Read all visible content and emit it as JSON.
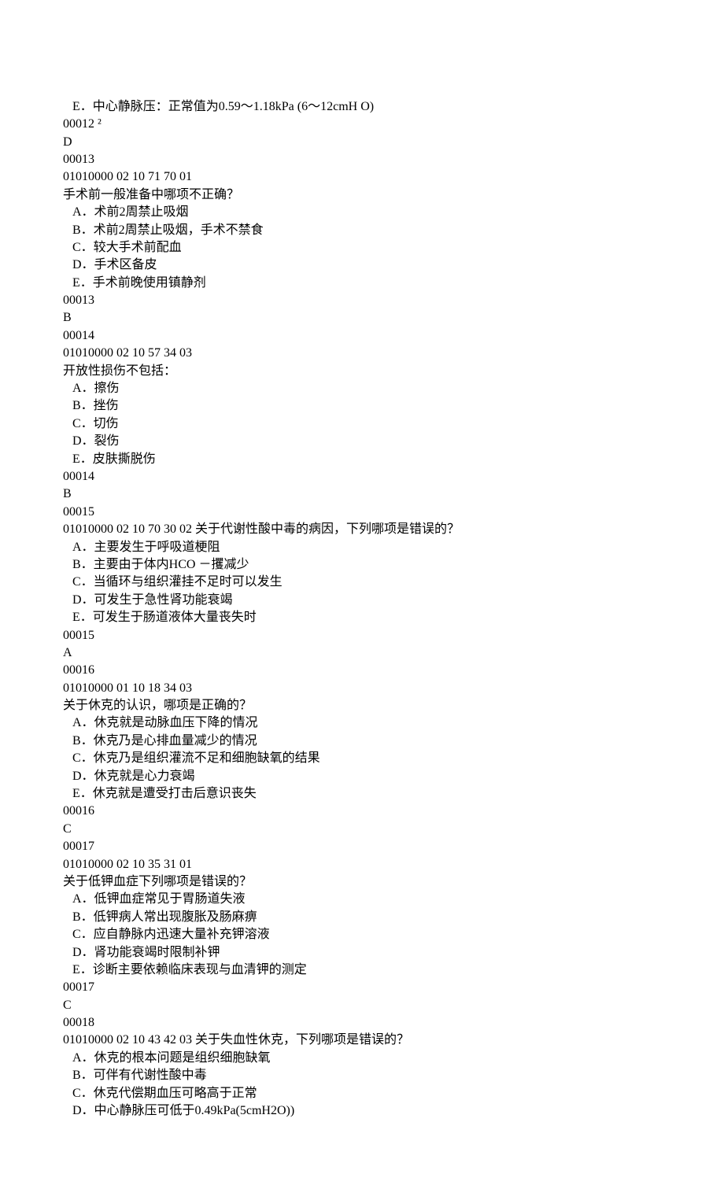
{
  "lines": [
    "   E．中心静脉压：正常值为0.59〜1.18kPa (6〜12cmH O)",
    "00012 ²",
    "D",
    "00013",
    "01010000 02 10 71 70 01",
    "手术前一般准备中哪项不正确？",
    "   A．术前2周禁止吸烟",
    "   B．术前2周禁止吸烟，手术不禁食",
    "   C．较大手术前配血",
    "   D．手术区备皮",
    "   E．手术前晚使用镇静剂",
    "00013",
    "B",
    "00014",
    "01010000 02 10 57 34 03",
    "开放性损伤不包括：",
    "   A．擦伤",
    "   B．挫伤",
    "   C．切伤",
    "   D．裂伤",
    "   E．皮肤撕脱伤",
    "00014",
    "B",
    "00015",
    "01010000 02 10 70 30 02 关于代谢性酸中毒的病因，下列哪项是错误的？",
    "   A．主要发生于呼吸道梗阻",
    "   B．主要由于体内HCO －攫减少",
    "   C．当循环与组织灌挂不足时可以发生",
    "   D．可发生于急性肾功能衰竭",
    "   E．可发生于肠道液体大量丧失时",
    "00015",
    "A",
    "00016",
    "01010000 01 10 18 34 03",
    "关于休克的认识，哪项是正确的？",
    "   A．休克就是动脉血压下降的情况",
    "   B．休克乃是心排血量减少的情况",
    "   C．休克乃是组织灌流不足和细胞缺氧的结果",
    "   D．休克就是心力衰竭",
    "   E．休克就是遭受打击后意识丧失",
    "00016",
    "C",
    "00017",
    "01010000 02 10 35 31 01",
    "关于低钾血症下列哪项是错误的？",
    "   A．低钾血症常见于胃肠道失液",
    "   B．低钾病人常出现腹胀及肠麻痹",
    "   C．应自静脉内迅速大量补充钾溶液",
    "   D．肾功能衰竭时限制补钾",
    "   E．诊断主要依赖临床表现与血清钾的测定",
    "00017",
    "C",
    "00018",
    "01010000 02 10 43 42 03 关于失血性休克，下列哪项是错误的？",
    "   A．休克的根本问题是组织细胞缺氧",
    "   B．可伴有代谢性酸中毒",
    "   C．休克代偿期血压可略高于正常",
    "   D．中心静脉压可低于0.49kPa(5cmH2O))"
  ]
}
